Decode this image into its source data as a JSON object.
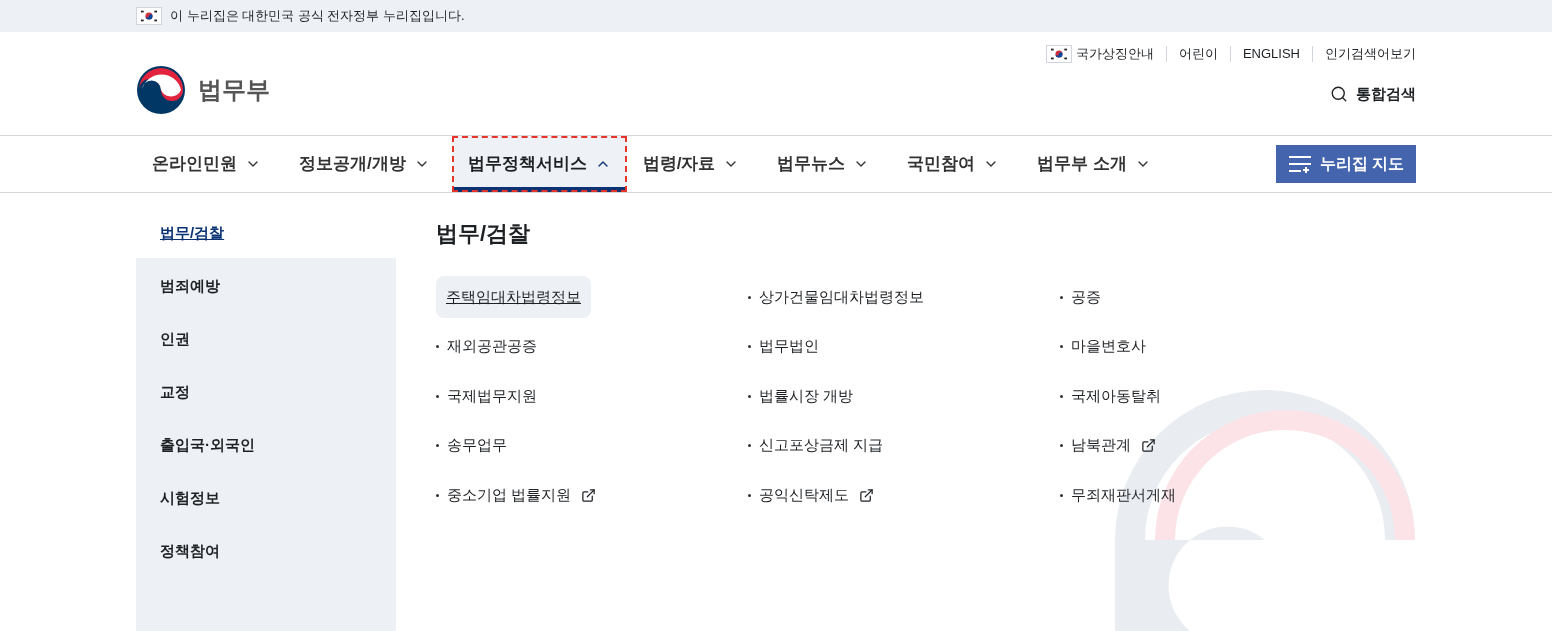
{
  "gov_banner": {
    "text": "이 누리집은 대한민국 공식 전자정부 누리집입니다."
  },
  "utility_links": [
    {
      "label": "국가상징안내",
      "kind": "flag"
    },
    {
      "label": "어린이",
      "kind": "plain"
    },
    {
      "label": "ENGLISH",
      "kind": "plain"
    },
    {
      "label": "인기검색어보기",
      "kind": "plain"
    }
  ],
  "logo": {
    "name": "법무부"
  },
  "search": {
    "label": "통합검색"
  },
  "nav": [
    {
      "label": "온라인민원",
      "selected": false
    },
    {
      "label": "정보공개/개방",
      "selected": false
    },
    {
      "label": "법무정책서비스",
      "selected": true
    },
    {
      "label": "법령/자료",
      "selected": false
    },
    {
      "label": "법무뉴스",
      "selected": false
    },
    {
      "label": "국민참여",
      "selected": false
    },
    {
      "label": "법무부 소개",
      "selected": false
    }
  ],
  "sitemap_button": {
    "label": "누리집 지도"
  },
  "sidebar": [
    {
      "label": "법무/검찰",
      "selected": true
    },
    {
      "label": "범죄예방",
      "selected": false
    },
    {
      "label": "인권",
      "selected": false
    },
    {
      "label": "교정",
      "selected": false
    },
    {
      "label": "출입국·외국인",
      "selected": false
    },
    {
      "label": "시험정보",
      "selected": false
    },
    {
      "label": "정책참여",
      "selected": false
    }
  ],
  "section_title": "법무/검찰",
  "links": [
    {
      "label": "주택임대차법령정보",
      "selected": true,
      "external": false
    },
    {
      "label": "상가건물임대차법령정보",
      "selected": false,
      "external": false
    },
    {
      "label": "공증",
      "selected": false,
      "external": false
    },
    {
      "label": "재외공관공증",
      "selected": false,
      "external": false
    },
    {
      "label": "법무법인",
      "selected": false,
      "external": false
    },
    {
      "label": "마을변호사",
      "selected": false,
      "external": false
    },
    {
      "label": "국제법무지원",
      "selected": false,
      "external": false
    },
    {
      "label": "법률시장 개방",
      "selected": false,
      "external": false
    },
    {
      "label": "국제아동탈취",
      "selected": false,
      "external": false
    },
    {
      "label": "송무업무",
      "selected": false,
      "external": false
    },
    {
      "label": "신고포상금제 지급",
      "selected": false,
      "external": false
    },
    {
      "label": "남북관계",
      "selected": false,
      "external": true
    },
    {
      "label": "중소기업 법률지원",
      "selected": false,
      "external": true
    },
    {
      "label": "공익신탁제도",
      "selected": false,
      "external": true
    },
    {
      "label": "무죄재판서게재",
      "selected": false,
      "external": false
    }
  ]
}
